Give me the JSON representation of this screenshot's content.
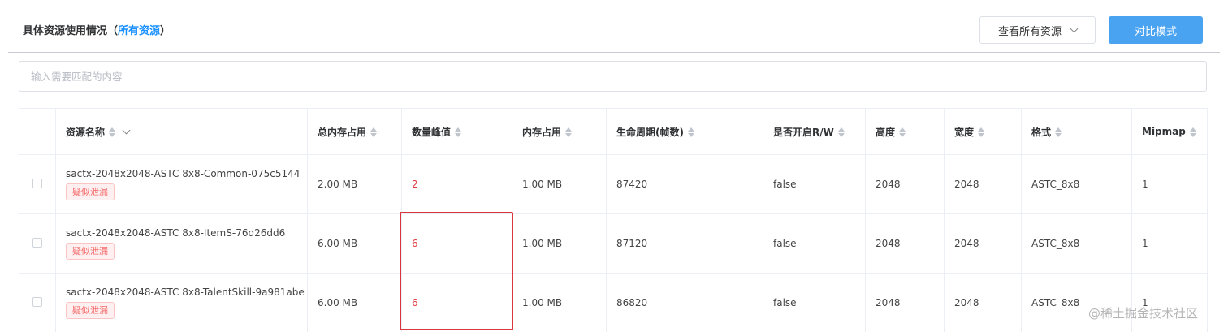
{
  "header": {
    "title": "具体资源使用情况",
    "paren_open": "（",
    "link": "所有资源",
    "paren_close": "）",
    "view_select": "查看所有资源",
    "compare_button": "对比模式"
  },
  "search": {
    "placeholder": "输入需要匹配的内容"
  },
  "table": {
    "columns": [
      "资源名称",
      "总内存占用",
      "数量峰值",
      "内存占用",
      "生命周期(帧数)",
      "是否开启R/W",
      "高度",
      "宽度",
      "格式",
      "Mipmap"
    ],
    "rows": [
      {
        "name": "sactx-2048x2048-ASTC 8x8-Common-075c5144",
        "tag": "疑似泄漏",
        "total_memory": "2.00 MB",
        "peak_count": "2",
        "memory": "1.00 MB",
        "lifecycle": "87420",
        "rw": "false",
        "height": "2048",
        "width": "2048",
        "format": "ASTC_8x8",
        "mipmap": "1"
      },
      {
        "name": "sactx-2048x2048-ASTC 8x8-ItemS-76d26dd6",
        "tag": "疑似泄漏",
        "total_memory": "6.00 MB",
        "peak_count": "6",
        "memory": "1.00 MB",
        "lifecycle": "87120",
        "rw": "false",
        "height": "2048",
        "width": "2048",
        "format": "ASTC_8x8",
        "mipmap": "1"
      },
      {
        "name": "sactx-2048x2048-ASTC 8x8-TalentSkill-9a981abe",
        "tag": "疑似泄漏",
        "total_memory": "6.00 MB",
        "peak_count": "6",
        "memory": "1.00 MB",
        "lifecycle": "86820",
        "rw": "false",
        "height": "2048",
        "width": "2048",
        "format": "ASTC_8x8",
        "mipmap": "1"
      }
    ]
  },
  "watermark": "@稀土掘金技术社区",
  "colors": {
    "primary": "#4aa3f0",
    "link": "#1890ff",
    "danger": "#e0393e",
    "tag_bg": "#fef0f0"
  }
}
